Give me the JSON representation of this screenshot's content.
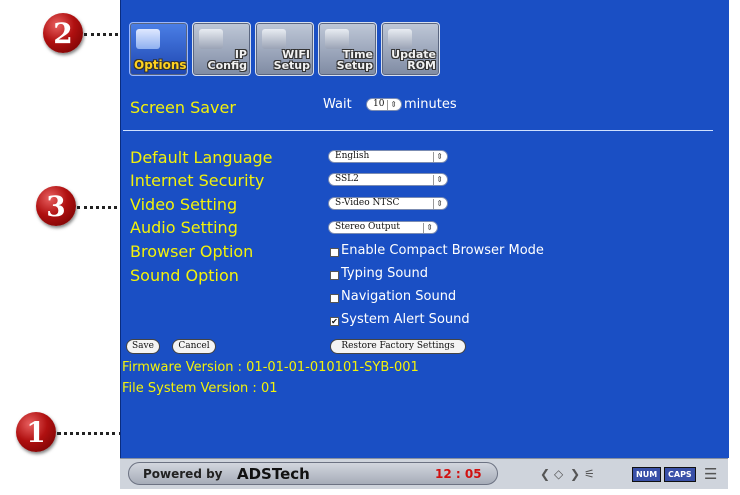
{
  "callouts": [
    "2",
    "3",
    "1"
  ],
  "tabs": [
    {
      "label": "Options",
      "icon": "options-icon",
      "active": true
    },
    {
      "label": "IP\nConfig",
      "icon": "network-config-icon",
      "active": false
    },
    {
      "label": "WIFI\nSetup",
      "icon": "wifi-router-icon",
      "active": false
    },
    {
      "label": "Time\nSetup",
      "icon": "clock-icon",
      "active": false
    },
    {
      "label": "Update\nROM",
      "icon": "rom-chip-icon",
      "active": false
    }
  ],
  "screen_saver": {
    "label": "Screen Saver",
    "prefix": "Wait",
    "value": "10",
    "suffix": "minutes"
  },
  "settings": {
    "default_language": {
      "label": "Default Language",
      "value": "English"
    },
    "internet_security": {
      "label": "Internet Security",
      "value": "SSL2"
    },
    "video_setting": {
      "label": "Video Setting",
      "value": "S-Video NTSC"
    },
    "audio_setting": {
      "label": "Audio Setting",
      "value": "Stereo Output"
    },
    "browser_option": {
      "label": "Browser Option",
      "checkbox": "Enable Compact Browser Mode",
      "checked": false
    },
    "sound_option": {
      "label": "Sound Option",
      "items": [
        {
          "label": "Typing Sound",
          "checked": false
        },
        {
          "label": "Navigation Sound",
          "checked": false
        },
        {
          "label": "System Alert Sound",
          "checked": true
        }
      ]
    }
  },
  "buttons": {
    "save": "Save",
    "cancel": "Cancel",
    "restore": "Restore Factory Settings"
  },
  "firmware": "Firmware Version : 01-01-01-010101-SYB-001",
  "filesystem": "File System Version : 01",
  "statusbar": {
    "powered_by": "Powered by",
    "brand": "ADSTech",
    "time": "12 : 05",
    "num": "NUM",
    "caps": "CAPS"
  },
  "colors": {
    "screen_bg": "#1a4fc4",
    "label_yellow": "#f3f20a",
    "callout_red": "#b01010"
  }
}
